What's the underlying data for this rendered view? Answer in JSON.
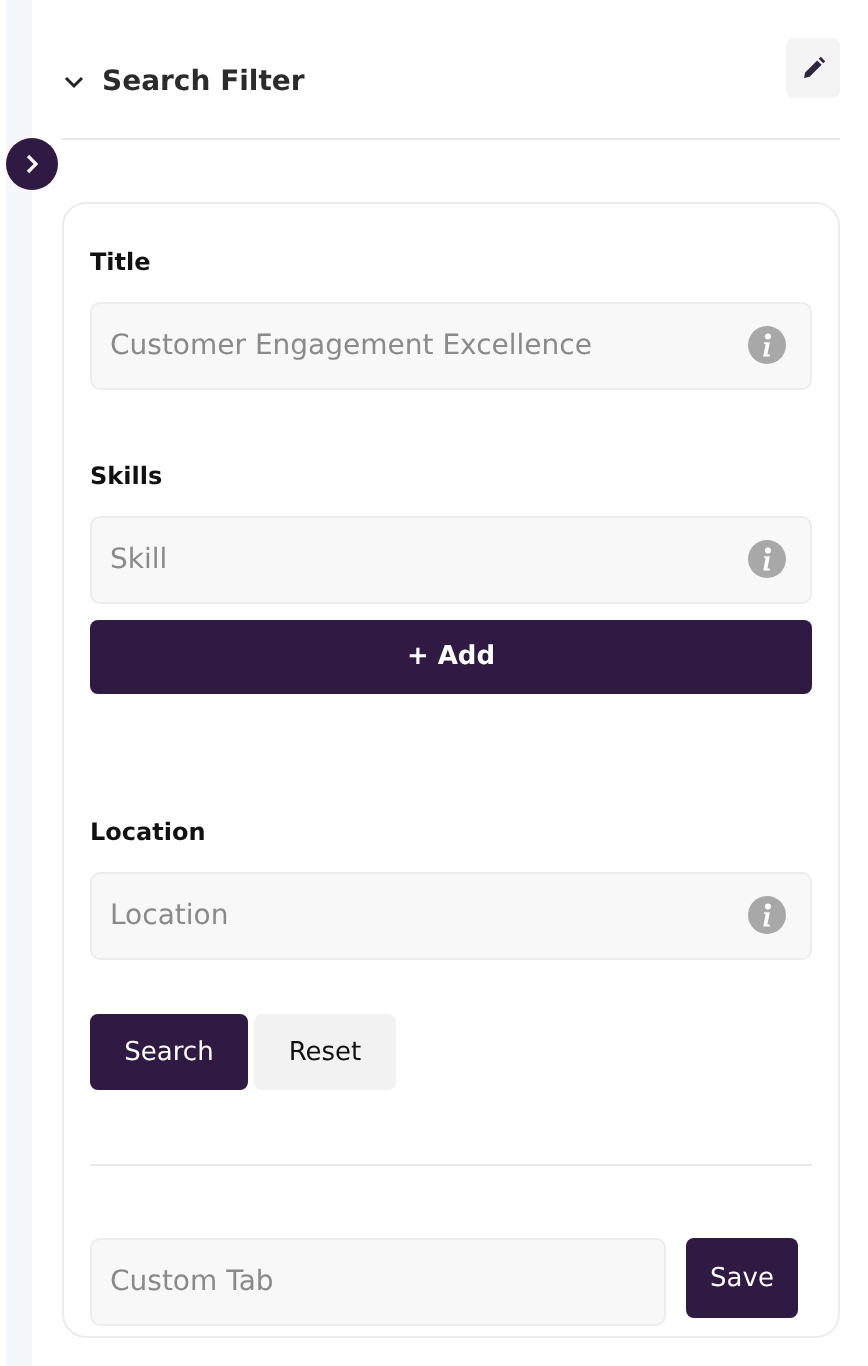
{
  "header": {
    "title": "Search Filter",
    "expanded": true
  },
  "fields": [
    {
      "label": "Title",
      "placeholder": "Customer Engagement Excellence"
    },
    {
      "label": "Skills",
      "placeholder": "Skill",
      "add_button": "+ Add"
    },
    {
      "label": "Location",
      "placeholder": "Location"
    }
  ],
  "actions": {
    "search": "Search",
    "reset": "Reset"
  },
  "custom_tab": {
    "placeholder": "Custom Tab",
    "save": "Save"
  }
}
